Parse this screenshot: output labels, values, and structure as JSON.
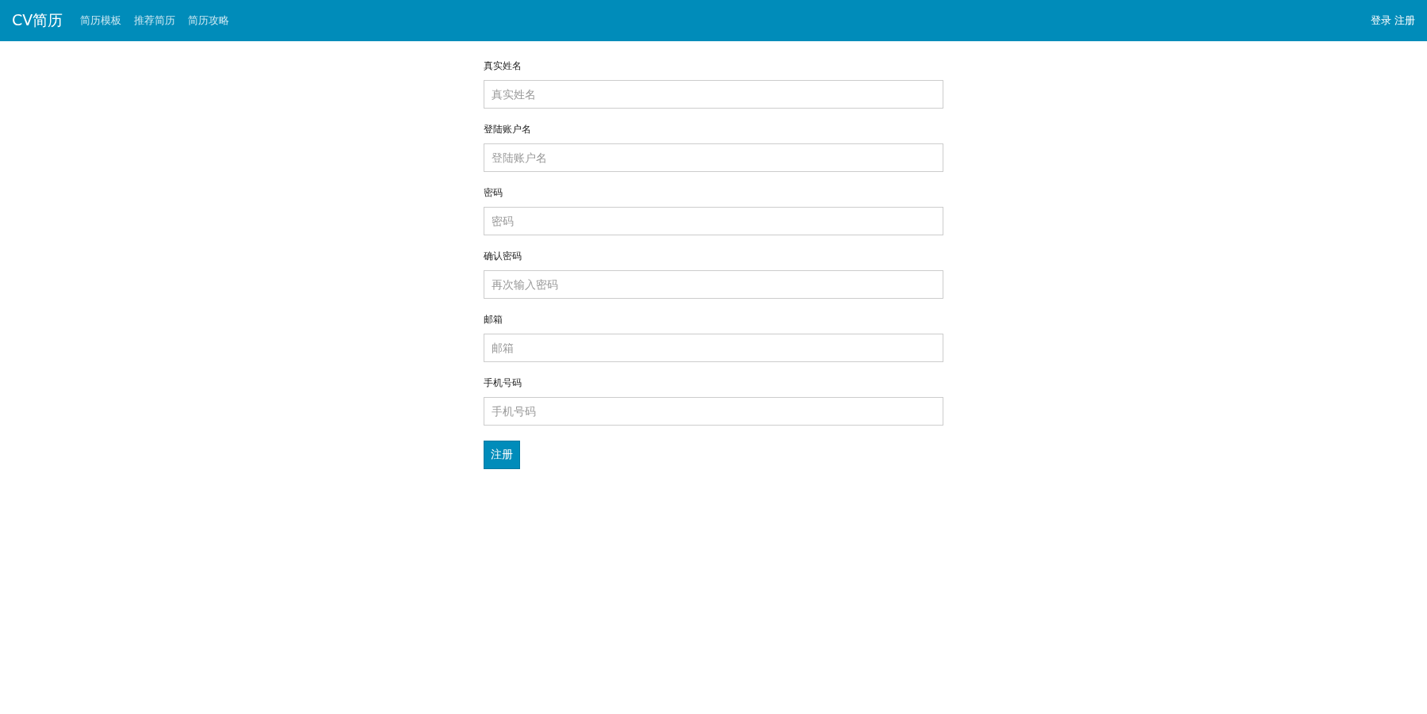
{
  "navbar": {
    "brand": "CV简历",
    "links": [
      {
        "label": "简历模板"
      },
      {
        "label": "推荐简历"
      },
      {
        "label": "简历攻略"
      }
    ],
    "auth_links": [
      {
        "label": "登录"
      },
      {
        "label": "注册"
      }
    ]
  },
  "form": {
    "fields": [
      {
        "label": "真实姓名",
        "placeholder": "真实姓名"
      },
      {
        "label": "登陆账户名",
        "placeholder": "登陆账户名"
      },
      {
        "label": "密码",
        "placeholder": "密码"
      },
      {
        "label": "确认密码",
        "placeholder": "再次输入密码"
      },
      {
        "label": "邮箱",
        "placeholder": "邮箱"
      },
      {
        "label": "手机号码",
        "placeholder": "手机号码"
      }
    ],
    "submit": "注册"
  }
}
